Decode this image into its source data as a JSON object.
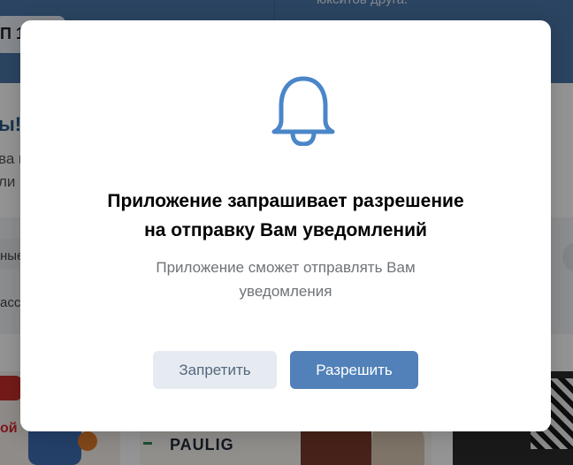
{
  "background": {
    "header_text": "юкситов друга.",
    "header_pill_text": "П 1",
    "banner_title": "ы!",
    "banner_line1": "ва н",
    "banner_line2": "ли",
    "chip1_text": "ные",
    "chip2_text": "асс",
    "card1_text": "ой",
    "card2_logo": "PAULIG"
  },
  "dialog": {
    "icon": "bell-icon",
    "title_line1": "Приложение запрашивает разрешение",
    "title_line2": "на отправку Вам уведомлений",
    "message_line1": "Приложение сможет отправлять Вам",
    "message_line2": "уведомления",
    "deny_label": "Запретить",
    "allow_label": "Разрешить"
  },
  "colors": {
    "accent": "#5181b8",
    "icon": "#4a86c8",
    "secondary_button": "#e5ebf1",
    "header": "#4a76a8"
  }
}
